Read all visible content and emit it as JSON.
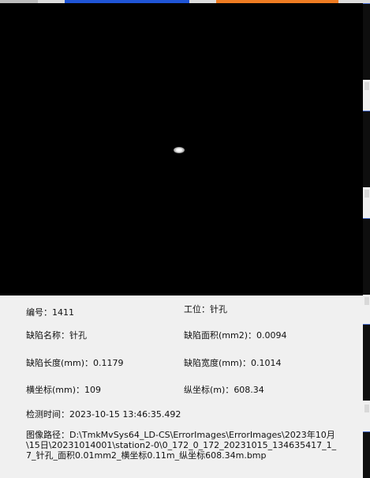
{
  "info": {
    "number_label": "编号：",
    "number_value": "1411",
    "station_label": "工位：",
    "station_value": "针孔",
    "defect_name_label": "缺陷名称：",
    "defect_name_value": "针孔",
    "defect_area_label": "缺陷面积(mm2)：",
    "defect_area_value": "0.0094",
    "defect_length_label": "缺陷长度(mm)：",
    "defect_length_value": "0.1179",
    "defect_width_label": "缺陷宽度(mm)：",
    "defect_width_value": "0.1014",
    "x_coord_label": "横坐标(mm)：",
    "x_coord_value": "109",
    "y_coord_label": "纵坐标(m)：",
    "y_coord_value": "608.34",
    "detect_time_label": "检测时间：",
    "detect_time_value": "2023-10-15 13:46:35.492",
    "image_path_label": "图像路径：",
    "image_path_value": "D:\\TmkMvSys64_LD-CS\\ErrorImages\\ErrorImages\\2023年10月\\15日\\20231014001\\station2-0\\0_172_0_172_20231015_134635417_1_7_针孔_面积0.01mm2_横坐标0.11m_纵坐标608.34m.bmp"
  },
  "colors": {
    "tab_active_blue": "#1f55d6",
    "tab_active_orange": "#ef7c22",
    "viewer_background": "#000000",
    "panel_background": "#f0f0f0"
  }
}
